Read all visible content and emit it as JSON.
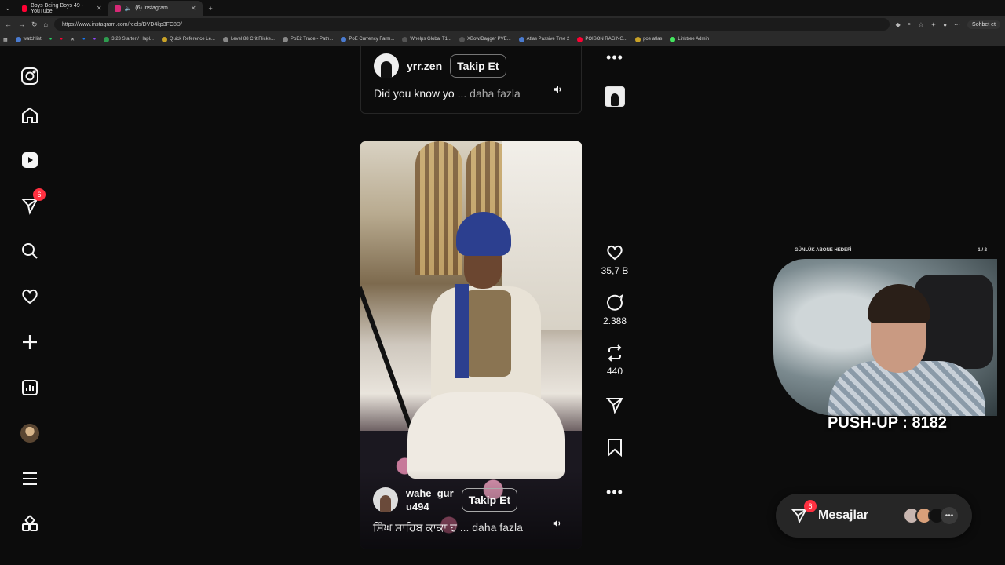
{
  "browser": {
    "tabs": [
      {
        "title": "Boys Being Boys 49 - YouTube",
        "favicon_color": "#ff0033"
      },
      {
        "title": "(6) Instagram",
        "favicon_color": "#d62976"
      }
    ],
    "url": "https://www.instagram.com/reels/DVD4kp3FC8D/",
    "chat_label": "Sohbet et",
    "bookmarks": [
      {
        "label": "watchlist",
        "color": "#4a7bd0"
      },
      {
        "label": "3.23 Starter / Hapl...",
        "color": "#2e9c4f"
      },
      {
        "label": "Quick Reference Le...",
        "color": "#c9a227"
      },
      {
        "label": "Level 88 Crit Flicke...",
        "color": "#888888"
      },
      {
        "label": "PoE2 Trade - Path...",
        "color": "#888888"
      },
      {
        "label": "PoE Currency Farm...",
        "color": "#4a7bd0"
      },
      {
        "label": "Whelps Global T1...",
        "color": "#333333"
      },
      {
        "label": "XBow/Dagger PVE...",
        "color": "#333333"
      },
      {
        "label": "Atlas Passive Tree 2",
        "color": "#4a7bd0"
      },
      {
        "label": "POISON RAGING...",
        "color": "#ff0033"
      },
      {
        "label": "poe atlas",
        "color": "#c9a227"
      },
      {
        "label": "Linktree Admin",
        "color": "#43e55e"
      }
    ]
  },
  "sidebar": {
    "notification_count": "6",
    "items": [
      {
        "name": "instagram-logo-icon"
      },
      {
        "name": "home-icon"
      },
      {
        "name": "reels-icon"
      },
      {
        "name": "messages-icon"
      },
      {
        "name": "search-icon"
      },
      {
        "name": "heart-icon"
      },
      {
        "name": "create-icon"
      },
      {
        "name": "dashboard-icon"
      },
      {
        "name": "profile-avatar"
      },
      {
        "name": "menu-icon"
      },
      {
        "name": "apps-icon"
      }
    ]
  },
  "reel_prev": {
    "username": "yrr.zen",
    "follow": "Takip Et",
    "caption": "Did you know yo",
    "more": "... daha fazla"
  },
  "reel_main": {
    "username_line1": "wahe_gur",
    "username_line2": "u494",
    "follow": "Takip Et",
    "caption": "ਸਿੰਘ ਸਾਹਿਬ ਕਾਕਾ ਹ",
    "more": "... daha fazla"
  },
  "actions": {
    "likes": "35,7 B",
    "comments": "2.388",
    "reposts": "440"
  },
  "overlay": {
    "goal_label": "GÜNLÜK ABONE HEDEFİ",
    "goal_value": "1 / 2",
    "pushup": "PUSH-UP : 8182"
  },
  "messages": {
    "label": "Mesajlar",
    "badge": "6"
  },
  "colors": {
    "accent_badge": "#ff3040",
    "background": "#0c0c0c"
  }
}
